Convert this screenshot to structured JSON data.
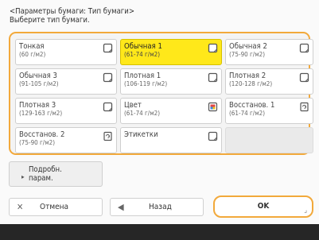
{
  "header": {
    "line1": "<Параметры бумаги: Тип бумаги>",
    "line2": "Выберите тип бумаги."
  },
  "paper_types": [
    {
      "name": "Тонкая",
      "range": "(60 г/м2)",
      "icon": "sheet-icon",
      "selected": false
    },
    {
      "name": "Обычная 1",
      "range": "(61-74 г/м2)",
      "icon": "sheet-icon",
      "selected": true
    },
    {
      "name": "Обычная 2",
      "range": "(75-90 г/м2)",
      "icon": "sheet-icon",
      "selected": false
    },
    {
      "name": "Обычная 3",
      "range": "(91-105 г/м2)",
      "icon": "sheet-icon",
      "selected": false
    },
    {
      "name": "Плотная 1",
      "range": "(106-119 г/м2)",
      "icon": "sheet-icon",
      "selected": false
    },
    {
      "name": "Плотная 2",
      "range": "(120-128 г/м2)",
      "icon": "sheet-icon",
      "selected": false
    },
    {
      "name": "Плотная 3",
      "range": "(129-163 г/м2)",
      "icon": "sheet-icon",
      "selected": false
    },
    {
      "name": "Цвет",
      "range": "(61-74 г/м2)",
      "icon": "color-sheet-icon",
      "selected": false
    },
    {
      "name": "Восстанов. 1",
      "range": "(61-74 г/м2)",
      "icon": "recycled-sheet-icon",
      "selected": false
    },
    {
      "name": "Восстанов. 2",
      "range": "(75-90 г/м2)",
      "icon": "recycled-sheet-icon",
      "selected": false
    },
    {
      "name": "Этикетки",
      "range": "",
      "icon": "sheet-icon",
      "selected": false
    }
  ],
  "details_button": {
    "line1": "Подробн.",
    "line2": "парам."
  },
  "buttons": {
    "cancel": "Отмена",
    "back": "Назад",
    "ok": "OK"
  },
  "colors": {
    "accent": "#f2a93b",
    "selected": "#ffe81a",
    "footer": "#262626"
  }
}
